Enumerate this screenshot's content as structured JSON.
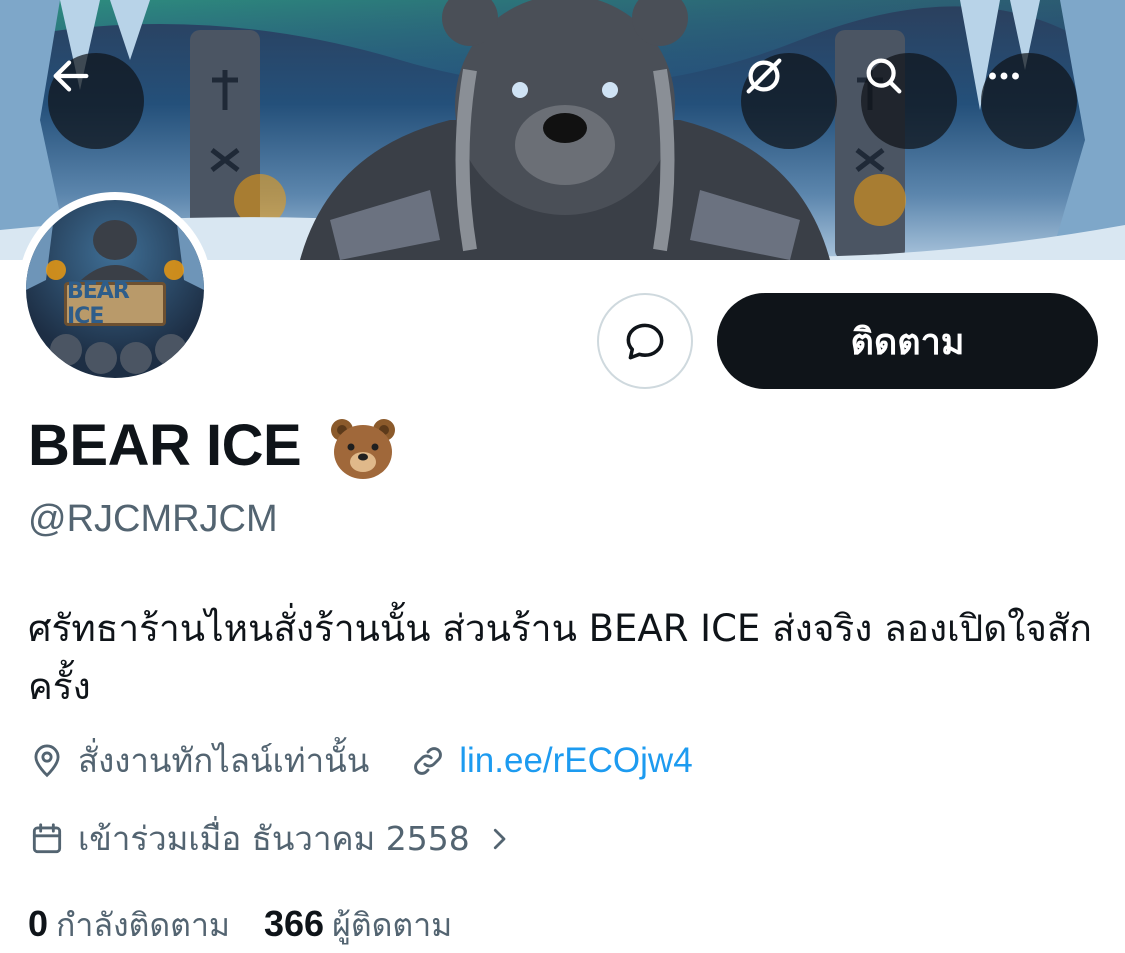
{
  "profile": {
    "display_name": "BEAR ICE",
    "display_name_emoji": "bear-face-emoji",
    "handle": "@RJCMRJCM",
    "bio": "ศรัทธาร้านไหนสั่งร้านนั้น ส่วนร้าน BEAR ICE ส่งจริง ลองเปิดใจสักครั้ง",
    "location": "สั่งงานทักไลน์เท่านั้น",
    "website": "lin.ee/rECOjw4",
    "joined": "เข้าร่วมเมื่อ ธันวาคม 2558",
    "avatar_sign_text": "BEAR ICE"
  },
  "actions": {
    "follow_label": "ติดตาม",
    "message_icon": "message-bubble-icon"
  },
  "header_icons": {
    "back": "arrow-left-icon",
    "grok": "grok-icon",
    "search": "search-icon",
    "more": "more-icon"
  },
  "stats": {
    "following_count": "0",
    "following_label": "กำลังติดตาม",
    "followers_count": "366",
    "followers_label": "ผู้ติดตาม"
  },
  "colors": {
    "primary_text": "#0f1419",
    "secondary_text": "#536471",
    "link": "#1d9bf0",
    "follow_button": "#0f1419"
  }
}
